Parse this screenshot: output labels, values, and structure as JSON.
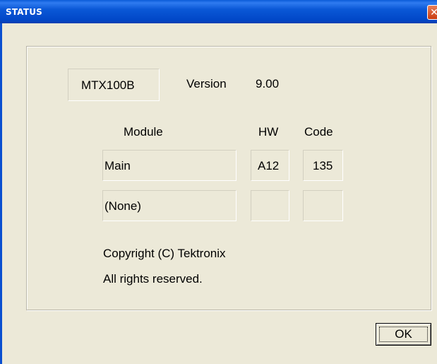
{
  "window": {
    "title": "STATUS",
    "close_glyph": "✕"
  },
  "device": {
    "model": "MTX100B",
    "version_label": "Version",
    "version_value": "9.00"
  },
  "table": {
    "headers": {
      "module": "Module",
      "hw": "HW",
      "code": "Code"
    },
    "rows": [
      {
        "module": "Main",
        "hw": "A12",
        "code": "135"
      },
      {
        "module": "(None)",
        "hw": "",
        "code": ""
      }
    ]
  },
  "copyright": {
    "line1": "Copyright (C) Tektronix",
    "line2": "All rights reserved."
  },
  "buttons": {
    "ok": "OK"
  }
}
